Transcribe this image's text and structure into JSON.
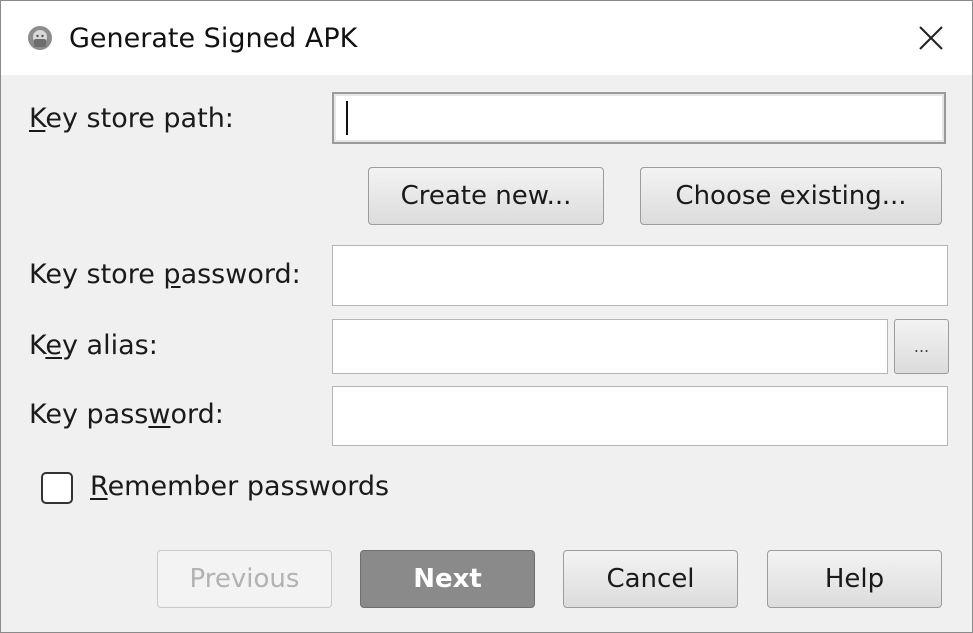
{
  "dialog": {
    "title": "Generate Signed APK",
    "close_symbol": "✕",
    "icon": "android-icon"
  },
  "form": {
    "key_store_path": {
      "label_ul": "K",
      "label_rest": "ey store path:",
      "value": ""
    },
    "create_new_label": "Create new...",
    "choose_existing_label": "Choose existing...",
    "key_store_password": {
      "label_pre": "Key store ",
      "label_ul": "p",
      "label_rest": "assword:",
      "value": ""
    },
    "key_alias": {
      "label_pre": "K",
      "label_ul": "e",
      "label_rest": "y alias:",
      "value": ""
    },
    "alias_browse_label": "...",
    "key_password": {
      "label_pre": "Key pass",
      "label_ul": "w",
      "label_rest": "ord:",
      "value": ""
    },
    "remember": {
      "label_ul": "R",
      "label_rest": "emember passwords",
      "checked": false
    }
  },
  "footer": {
    "previous_label": "Previous",
    "next_label": "Next",
    "cancel_label": "Cancel",
    "help_label": "Help"
  },
  "colors": {
    "window_bg": "#f0f0f0",
    "titlebar_bg": "#ffffff",
    "default_button": "#8a8a8a"
  }
}
